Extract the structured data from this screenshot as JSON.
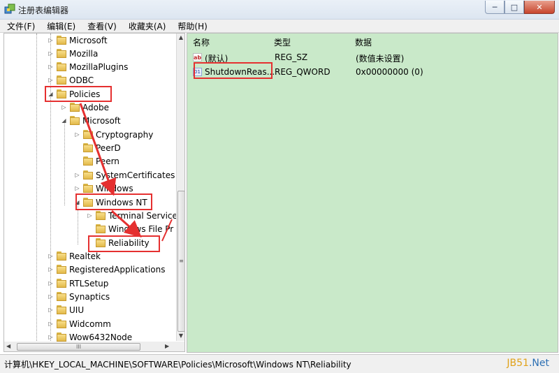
{
  "window": {
    "title": "注册表编辑器"
  },
  "window_controls": {
    "minimize": "─",
    "maximize": "□",
    "close": "✕"
  },
  "menu": [
    "文件(F)",
    "编辑(E)",
    "查看(V)",
    "收藏夹(A)",
    "帮助(H)"
  ],
  "tree": [
    {
      "label": "Microsoft",
      "expander": "▷"
    },
    {
      "label": "Mozilla",
      "expander": "▷"
    },
    {
      "label": "MozillaPlugins",
      "expander": "▷"
    },
    {
      "label": "ODBC",
      "expander": "▷"
    },
    {
      "label": "Policies",
      "expander": "◢"
    },
    {
      "label": "Adobe",
      "expander": "▷"
    },
    {
      "label": "Microsoft",
      "expander": "◢"
    },
    {
      "label": "Cryptography",
      "expander": "▷"
    },
    {
      "label": "PeerD",
      "expander": ""
    },
    {
      "label": "Peern",
      "expander": ""
    },
    {
      "label": "SystemCertificates",
      "expander": "▷"
    },
    {
      "label": "Windows",
      "expander": "▷"
    },
    {
      "label": "Windows NT",
      "expander": "◢"
    },
    {
      "label": "Terminal Service",
      "expander": "▷"
    },
    {
      "label": "Windows File Pr",
      "expander": ""
    },
    {
      "label": "Reliability",
      "expander": ""
    },
    {
      "label": "Realtek",
      "expander": "▷"
    },
    {
      "label": "RegisteredApplications",
      "expander": "▷"
    },
    {
      "label": "RTLSetup",
      "expander": "▷"
    },
    {
      "label": "Synaptics",
      "expander": "▷"
    },
    {
      "label": "UIU",
      "expander": "▷"
    },
    {
      "label": "Widcomm",
      "expander": "▷"
    },
    {
      "label": "Wow6432Node",
      "expander": "▷"
    }
  ],
  "scroll_glyphs": {
    "up": "▲",
    "down": "▼",
    "left": "◀",
    "right": "▶",
    "grip_v": "≡",
    "grip_h": "III"
  },
  "list": {
    "columns": [
      "名称",
      "类型",
      "数据"
    ],
    "rows": [
      {
        "icon": "ab",
        "name": "(默认)",
        "type": "REG_SZ",
        "data": "(数值未设置)"
      },
      {
        "icon": "01",
        "name": "ShutdownReas...",
        "type": "REG_QWORD",
        "data": "0x00000000 (0)"
      }
    ]
  },
  "status": {
    "path": "计算机\\HKEY_LOCAL_MACHINE\\SOFTWARE\\Policies\\Microsoft\\Windows NT\\Reliability"
  },
  "watermark": {
    "part1": "JB51",
    "part2": ".Net"
  },
  "colors": {
    "list_bg": "#c9e9c9",
    "highlight": "#e53030",
    "watermark_1": "#e0a21a",
    "watermark_2": "#2c6fb3"
  }
}
